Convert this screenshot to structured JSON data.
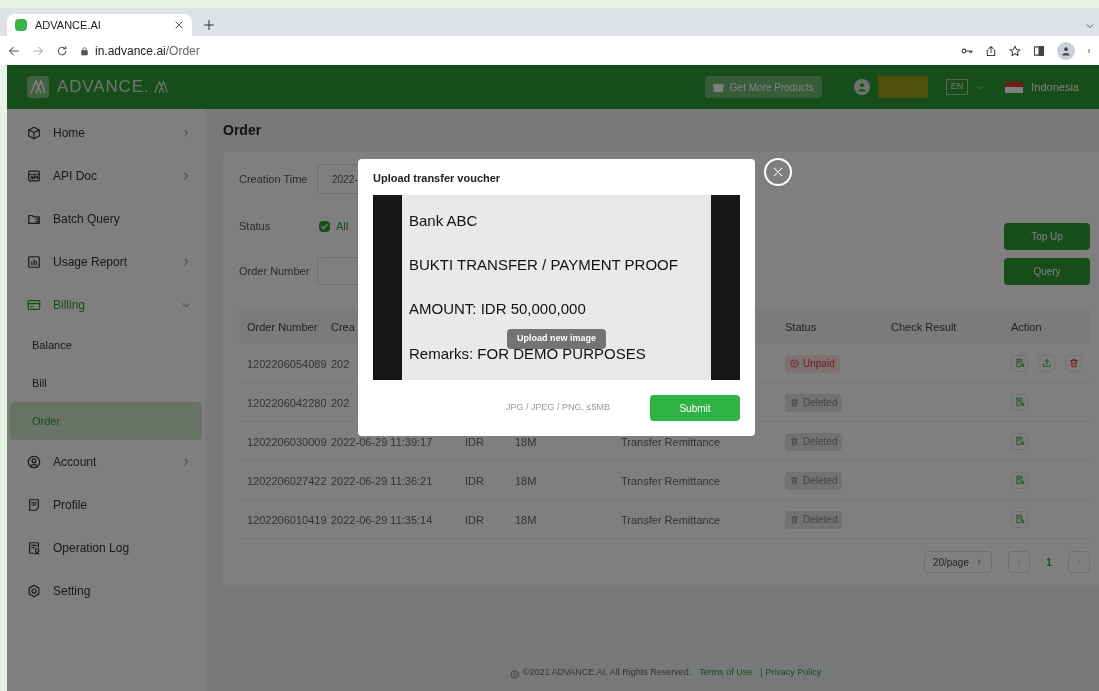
{
  "browser": {
    "tab_title": "ADVANCE.AI",
    "url_host": "in.advance.ai",
    "url_path": "/Order"
  },
  "header": {
    "logo_text": "ADVANCE.",
    "products_button": "Get More Products",
    "language": "EN",
    "country": "Indonesia"
  },
  "sidebar": {
    "items": [
      {
        "label": "Home",
        "kind": "arrow",
        "expanded": false,
        "selected": false
      },
      {
        "label": "API Doc",
        "kind": "arrow",
        "expanded": false,
        "selected": false
      },
      {
        "label": "Batch Query",
        "kind": "plain",
        "expanded": false,
        "selected": false
      },
      {
        "label": "Usage Report",
        "kind": "arrow",
        "expanded": false,
        "selected": false
      },
      {
        "label": "Billing",
        "kind": "arrow",
        "expanded": true,
        "selected": true,
        "children": [
          {
            "label": "Balance",
            "selected": false
          },
          {
            "label": "Bill",
            "selected": false
          },
          {
            "label": "Order",
            "selected": true
          }
        ]
      },
      {
        "label": "Account",
        "kind": "arrow",
        "expanded": false,
        "selected": false
      },
      {
        "label": "Profile",
        "kind": "plain",
        "expanded": false,
        "selected": false
      },
      {
        "label": "Operation Log",
        "kind": "plain",
        "expanded": false,
        "selected": false
      },
      {
        "label": "Setting",
        "kind": "plain",
        "expanded": false,
        "selected": false
      }
    ]
  },
  "page_title": "Order",
  "filters": {
    "creation_time_label": "Creation Time",
    "creation_time_value": "2022-",
    "status_label": "Status",
    "status_option": {
      "label": "All",
      "checked": true
    },
    "order_number_label": "Order Number",
    "top_up_button": "Top Up",
    "query_button": "Query"
  },
  "table": {
    "columns": [
      "Order Number",
      "Crea",
      "Status",
      "Check Result",
      "Action"
    ],
    "rows": [
      {
        "order_number": "1202206054089",
        "creation_time": "202",
        "status": {
          "kind": "unpaid",
          "label": "Unpaid"
        },
        "actions": [
          {
            "kind": "view"
          },
          {
            "kind": "upload"
          },
          {
            "kind": "delete"
          }
        ]
      },
      {
        "order_number": "1202206042280",
        "creation_time": "202",
        "status": {
          "kind": "deleted",
          "label": "Deleted"
        },
        "actions": [
          {
            "kind": "view"
          }
        ]
      },
      {
        "order_number": "1202206030009",
        "creation_time": "2022-06-29 11:39:17",
        "currency": "IDR",
        "amount": "18M",
        "type": "Transfer Remittance",
        "status": {
          "kind": "deleted",
          "label": "Deleted"
        },
        "actions": [
          {
            "kind": "view"
          }
        ]
      },
      {
        "order_number": "1202206027422",
        "creation_time": "2022-06-29 11:36:21",
        "currency": "IDR",
        "amount": "18M",
        "type": "Transfer Remittance",
        "status": {
          "kind": "deleted",
          "label": "Deleted"
        },
        "actions": [
          {
            "kind": "view"
          }
        ]
      },
      {
        "order_number": "1202206010419",
        "creation_time": "2022-06-29 11:35:14",
        "currency": "IDR",
        "amount": "18M",
        "type": "Transfer Remittance",
        "status": {
          "kind": "deleted",
          "label": "Deleted"
        },
        "actions": [
          {
            "kind": "view"
          }
        ]
      }
    ]
  },
  "pagination": {
    "page_size": "20/page",
    "pages": [
      {
        "label": "1",
        "selected": true
      }
    ]
  },
  "footer": {
    "copyright": "©2021 ADVANCE.AI. All Rights Reserved.",
    "links": [
      "Terms of Use",
      "| Privacy Policy"
    ]
  },
  "modal": {
    "title": "Upload transfer voucher",
    "document_lines": [
      "Bank ABC",
      "BUKTI TRANSFER / PAYMENT PROOF",
      "AMOUNT: IDR 50,000,000",
      "Remarks: FOR DEMO PURPOSES"
    ],
    "upload_button": "Upload new image",
    "hint": "JPG / JPEG / PNG, ≤5MB",
    "submit_button": "Submit"
  }
}
